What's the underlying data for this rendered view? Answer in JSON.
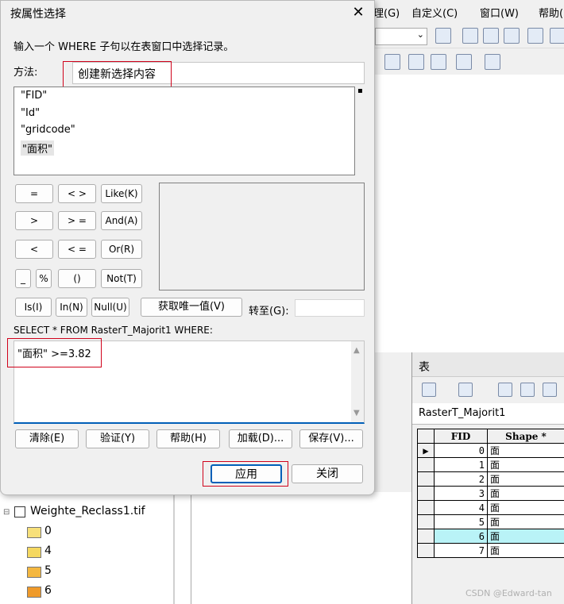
{
  "menubar": {
    "items": [
      "理(G)",
      "自定义(C)",
      "窗口(W)",
      "帮助("
    ]
  },
  "dialog": {
    "title": "按属性选择",
    "close_glyph": "✕",
    "prompt": "输入一个 WHERE 子句以在表窗口中选择记录。",
    "method_label": "方法:",
    "method_value": "创建新选择内容",
    "fields": [
      "\"FID\"",
      "\"Id\"",
      "\"gridcode\"",
      "\"面积\""
    ],
    "operators": {
      "eq": "=",
      "ne": "< >",
      "like": "Like(K)",
      "gt": ">",
      "ge": "> =",
      "and": "And(A)",
      "lt": "<",
      "le": "< =",
      "or": "Or(R)",
      "underscore": "_",
      "percent": "%",
      "parens": "()",
      "not": "Not(T)",
      "is": "Is(I)",
      "in": "In(N)",
      "null": "Null(U)"
    },
    "unique_values_button": "获取唯一值(V)",
    "goto_label": "转至(G):",
    "sql_prefix": "SELECT * FROM RasterT_Majorit1 WHERE:",
    "sql_expression": "\"面积\" >=3.82",
    "buttons": {
      "clear": "清除(E)",
      "verify": "验证(Y)",
      "help": "帮助(H)",
      "load": "加载(D)...",
      "save": "保存(V)...",
      "apply": "应用",
      "close": "关闭"
    }
  },
  "table_window": {
    "title": "表",
    "tab": "RasterT_Majorit1",
    "columns": [
      "FID",
      "Shape *"
    ],
    "rows": [
      {
        "fid": "0",
        "shape": "面",
        "current": true
      },
      {
        "fid": "1",
        "shape": "面"
      },
      {
        "fid": "2",
        "shape": "面"
      },
      {
        "fid": "3",
        "shape": "面"
      },
      {
        "fid": "4",
        "shape": "面"
      },
      {
        "fid": "5",
        "shape": "面"
      },
      {
        "fid": "6",
        "shape": "面",
        "highlighted": true
      },
      {
        "fid": "7",
        "shape": "面"
      }
    ],
    "highlight_color": "#b9f3f7"
  },
  "toc": {
    "layer_name": "Weighte_Reclass1.tif",
    "legend": [
      {
        "label": "0",
        "color": "#f7e07a"
      },
      {
        "label": "4",
        "color": "#f5d860"
      },
      {
        "label": "5",
        "color": "#f4b740"
      },
      {
        "label": "6",
        "color": "#ef9a2a"
      }
    ]
  },
  "watermark": "CSDN @Edward-tan",
  "colors": {
    "annotation_red": "#d0021b",
    "focus_blue": "#005fb8"
  }
}
